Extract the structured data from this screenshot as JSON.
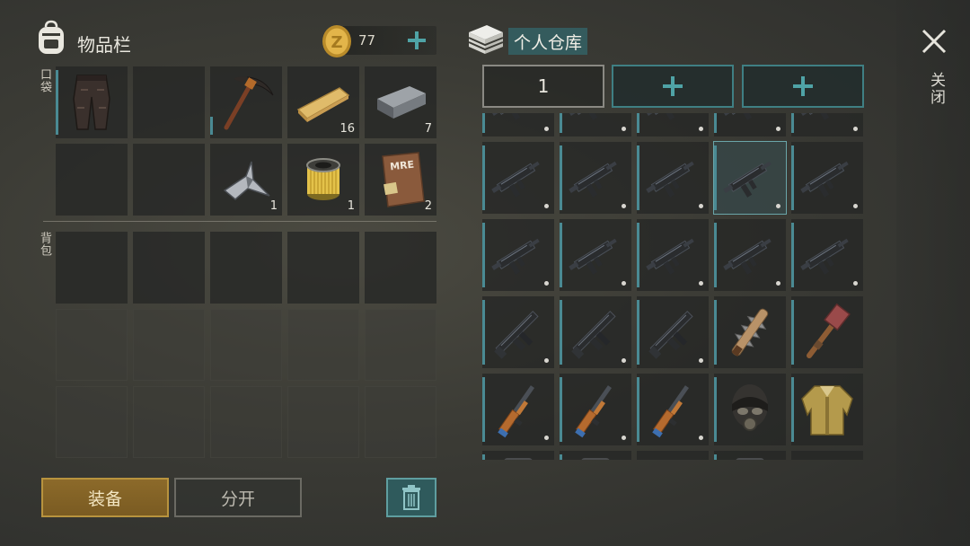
{
  "inventory": {
    "title": "物品栏",
    "coins": "77",
    "pocket_label": "口袋",
    "backpack_label": "背包",
    "pocket_items": [
      {
        "icon": "pants",
        "count": ""
      },
      {
        "icon": "",
        "count": ""
      },
      {
        "icon": "pickaxe",
        "count": ""
      },
      {
        "icon": "wood-plank",
        "count": "16"
      },
      {
        "icon": "iron-bar",
        "count": "7"
      },
      {
        "icon": "",
        "count": ""
      },
      {
        "icon": "",
        "count": ""
      },
      {
        "icon": "metal-parts",
        "count": "1"
      },
      {
        "icon": "filter",
        "count": "1"
      },
      {
        "icon": "mre-ration",
        "count": "2"
      }
    ]
  },
  "buttons": {
    "equip": "装备",
    "split": "分开"
  },
  "storage": {
    "title": "个人仓库",
    "tab_1": "1",
    "rows": [
      [
        "smg",
        "smg",
        "smg",
        "smg",
        "smg"
      ],
      [
        "smg",
        "smg",
        "smg",
        "smg",
        "smg"
      ],
      [
        "smg",
        "smg",
        "smg",
        "smg",
        "smg"
      ],
      [
        "rifle",
        "rifle",
        "rifle",
        "spiked-club",
        "hammer"
      ],
      [
        "shotgun",
        "shotgun",
        "shotgun",
        "gas-mask",
        "jacket"
      ],
      [
        "item",
        "item",
        "",
        "item",
        ""
      ]
    ]
  },
  "close_label": "关闭",
  "colors": {
    "accent_teal": "#345b5d",
    "equip_gold": "#8c6a2a",
    "slot_bg": "#252725"
  }
}
